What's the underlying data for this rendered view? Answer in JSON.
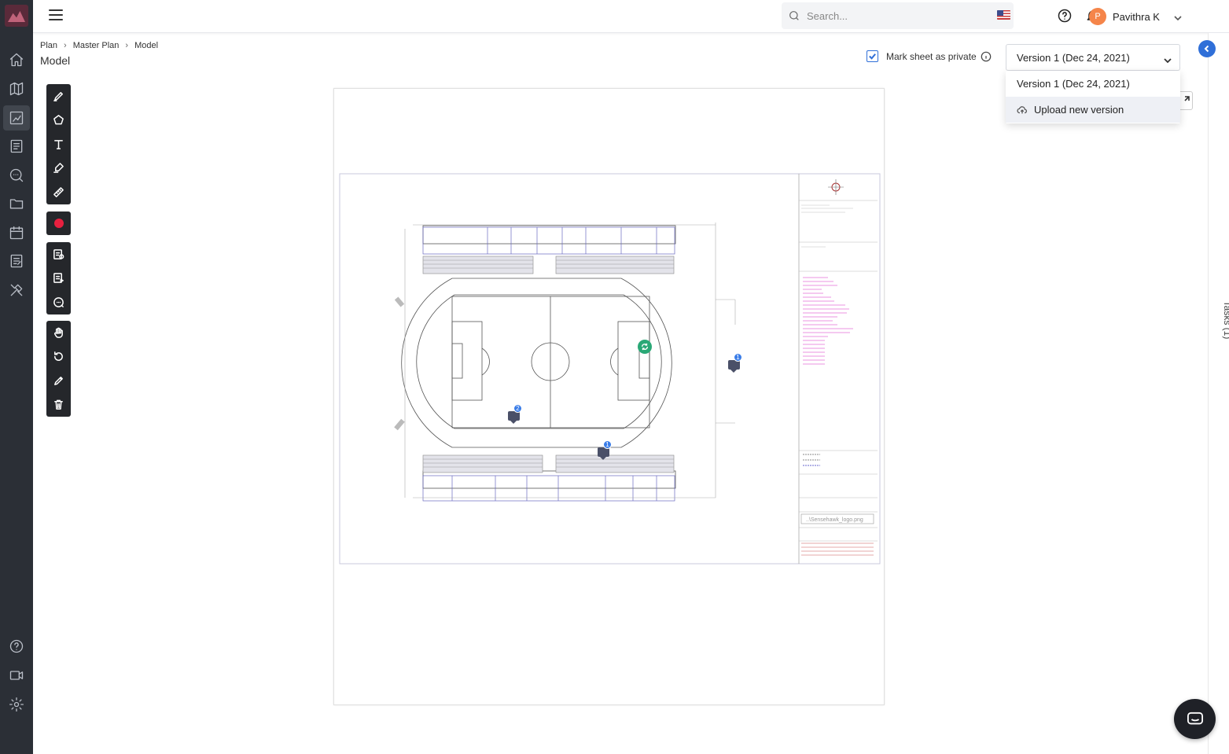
{
  "header": {
    "search_placeholder": "Search...",
    "user_initial": "P",
    "user_name": "Pavithra K"
  },
  "breadcrumb": [
    "Plan",
    "Master Plan",
    "Model"
  ],
  "page_title": "Model",
  "private_toggle": {
    "label": "Mark sheet as private",
    "checked": true
  },
  "version": {
    "selected": "Version 1 (Dec 24, 2021)",
    "options": [
      "Version 1 (Dec 24, 2021)",
      "Upload new version"
    ]
  },
  "right_panel": {
    "tasks_label": "Tasks (1)"
  },
  "sidebar": {
    "items": [
      "home-icon",
      "map-icon",
      "plans-icon",
      "checklist-icon",
      "search-chat-icon",
      "folder-icon",
      "calendar-icon",
      "forms-icon",
      "tools-icon"
    ],
    "bottom": [
      "help-icon",
      "video-icon",
      "settings-icon"
    ]
  },
  "toolbar": {
    "annotation_color": "#e8203f",
    "groups": [
      [
        "pencil-icon",
        "polygon-icon",
        "text-icon",
        "marker-icon",
        "ruler-icon"
      ],
      [
        "color-dot"
      ],
      [
        "task-icon",
        "form-icon",
        "comment-icon"
      ],
      [
        "hand-icon",
        "rotate-icon",
        "edit-icon",
        "trash-icon"
      ]
    ]
  },
  "markers": [
    {
      "type": "comment",
      "count": "1",
      "name": "comment-marker-east"
    },
    {
      "type": "comment",
      "count": "2",
      "name": "comment-marker-field"
    },
    {
      "type": "comment",
      "count": "1",
      "name": "comment-marker-south"
    }
  ],
  "title_block": {
    "logo_text": "..\\Sensehawk_logo.png"
  },
  "colors": {
    "accent": "#2f6fd8",
    "sidebar": "#2b2f36",
    "avatar": "#f5854a",
    "task_marker": "#2aa876"
  }
}
